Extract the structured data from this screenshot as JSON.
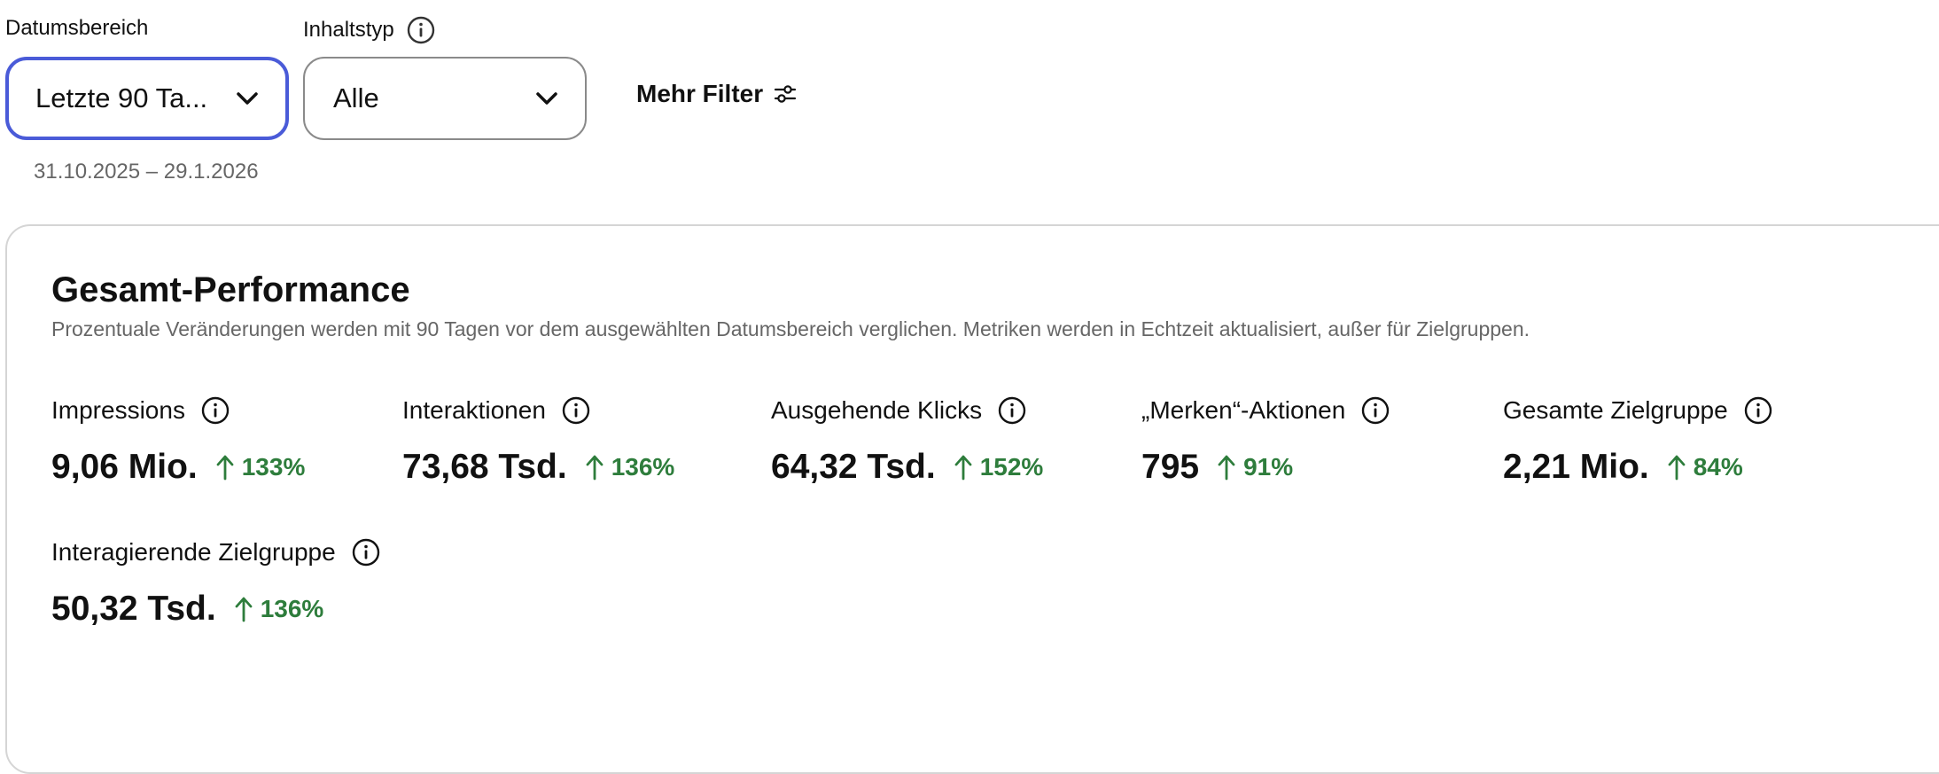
{
  "filters": {
    "date_range": {
      "label": "Datumsbereich",
      "value": "Letzte 90 Ta...",
      "range_text": "31.10.2025 – 29.1.2026"
    },
    "content_type": {
      "label": "Inhaltstyp",
      "value": "Alle"
    },
    "more_filters_label": "Mehr Filter"
  },
  "overview": {
    "title": "Gesamt-Performance",
    "subtitle": "Prozentuale Veränderungen werden mit 90 Tagen vor dem ausgewählten Datumsbereich verglichen. Metriken werden in Echtzeit aktualisiert, außer für Zielgruppen.",
    "metrics": [
      {
        "label": "Impressions",
        "value": "9,06 Mio.",
        "change": "133%"
      },
      {
        "label": "Interaktionen",
        "value": "73,68 Tsd.",
        "change": "136%"
      },
      {
        "label": "Ausgehende Klicks",
        "value": "64,32 Tsd.",
        "change": "152%"
      },
      {
        "label": "„Merken“-Aktionen",
        "value": "795",
        "change": "91%"
      },
      {
        "label": "Gesamte Zielgruppe",
        "value": "2,21 Mio.",
        "change": "84%"
      },
      {
        "label": "Interagierende Zielgruppe",
        "value": "50,32 Tsd.",
        "change": "136%"
      }
    ]
  },
  "colors": {
    "accent_focus": "#4a5bd8",
    "positive_change": "#2e7d3c",
    "muted_text": "#666666",
    "border": "#d5d5d5"
  },
  "icons": {
    "info": "info-circle-icon",
    "chevron": "chevron-down-icon",
    "filter": "sliders-icon",
    "trend": "arrow-up-icon"
  }
}
